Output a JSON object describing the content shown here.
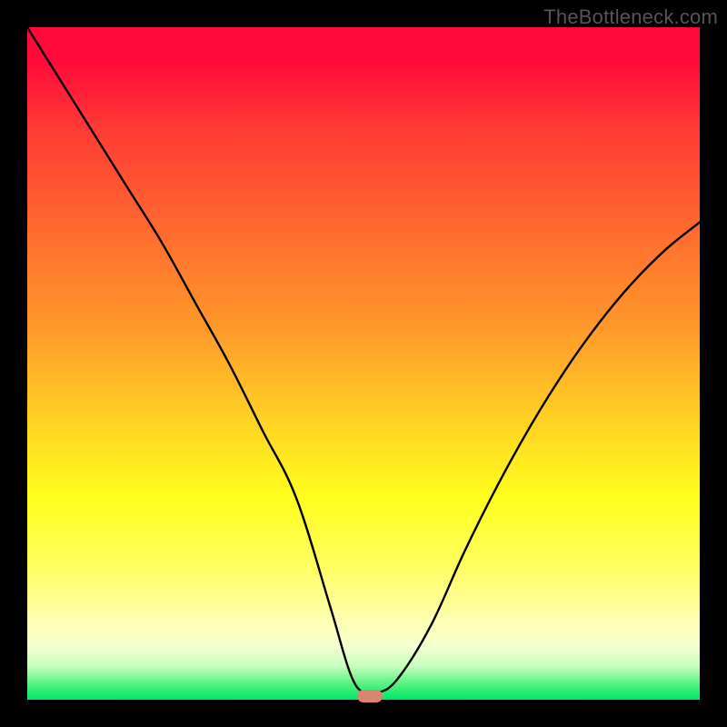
{
  "watermark": "TheBottleneck.com",
  "chart_data": {
    "type": "line",
    "title": "",
    "xlabel": "",
    "ylabel": "",
    "xlim": [
      0,
      100
    ],
    "ylim": [
      0,
      100
    ],
    "series": [
      {
        "name": "bottleneck-curve",
        "x": [
          0,
          5,
          10,
          15,
          20,
          25,
          30,
          35,
          40,
          45,
          48,
          50,
          52,
          55,
          60,
          65,
          70,
          75,
          80,
          85,
          90,
          95,
          100
        ],
        "values": [
          100,
          92,
          84,
          76,
          68,
          59,
          50,
          40,
          30,
          14,
          4,
          1,
          1,
          3,
          11,
          22,
          32,
          41,
          49,
          56,
          62,
          67,
          71
        ]
      }
    ],
    "marker": {
      "x": 51,
      "y": 0.5
    },
    "background_gradient": {
      "stops": [
        {
          "pos": 0,
          "color": "#ff0a3a"
        },
        {
          "pos": 15,
          "color": "#ff3a35"
        },
        {
          "pos": 30,
          "color": "#ff6a2f"
        },
        {
          "pos": 45,
          "color": "#ff9a2a"
        },
        {
          "pos": 58,
          "color": "#ffd024"
        },
        {
          "pos": 70,
          "color": "#ffff1e"
        },
        {
          "pos": 88,
          "color": "#ffffb0"
        },
        {
          "pos": 95,
          "color": "#c8ffbe"
        },
        {
          "pos": 100,
          "color": "#00e86a"
        }
      ]
    }
  }
}
